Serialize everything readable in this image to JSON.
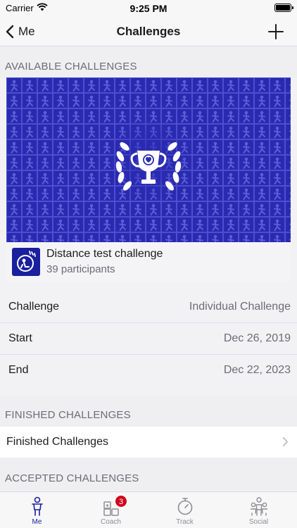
{
  "status": {
    "carrier": "Carrier",
    "time": "9:25 PM"
  },
  "nav": {
    "back_label": "Me",
    "title": "Challenges"
  },
  "sections": {
    "available": "AVAILABLE CHALLENGES",
    "finished": "FINISHED CHALLENGES",
    "accepted": "ACCEPTED CHALLENGES"
  },
  "card": {
    "title": "Distance test challenge",
    "participants": "39 participants"
  },
  "pager": {
    "count": 4,
    "active": 0
  },
  "details": [
    {
      "label": "Challenge",
      "value": "Individual Challenge"
    },
    {
      "label": "Start",
      "value": "Dec 26, 2019"
    },
    {
      "label": "End",
      "value": "Dec 22, 2023"
    }
  ],
  "finished_row": {
    "label": "Finished Challenges"
  },
  "tabs": [
    {
      "label": "Me",
      "icon": "person-icon",
      "active": true
    },
    {
      "label": "Coach",
      "icon": "coach-icon",
      "badge": "3"
    },
    {
      "label": "Track",
      "icon": "stopwatch-icon"
    },
    {
      "label": "Social",
      "icon": "people-icon"
    }
  ],
  "colors": {
    "accent": "#1a1f9e",
    "banner": "#2a2ab0",
    "badge": "#d0021b"
  }
}
